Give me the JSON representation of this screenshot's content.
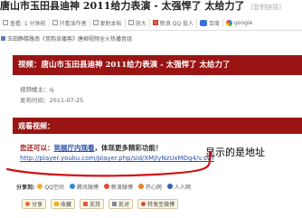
{
  "page_title": {
    "text": "唐山市玉田县迪神 2011给力表演 - 太强悍了 太给力了",
    "tag": "[复制链接]"
  },
  "toolbar": {
    "items": [
      {
        "label": "查看: 1 分钟前",
        "icon": "eye-icon"
      },
      {
        "label": "只看该作者",
        "icon": "user-icon"
      },
      {
        "label": "复制本帖",
        "icon": "copy-icon"
      },
      {
        "label": "放大",
        "icon": "zoom-icon"
      },
      {
        "label": "新浪 QQ 投人",
        "icon": "share-icon"
      },
      {
        "label": "百度",
        "icon": "baidu-icon"
      },
      {
        "label": "google",
        "icon": "google-icon"
      }
    ]
  },
  "breadcrumb": {
    "text": "玉田静楼路南《音韵谈播客》唐柳视频全火热播音组"
  },
  "video_title": "视频：唐山市玉田县迪神 2011给力表演 - 太强悍了 太给力了",
  "meta": {
    "uploader": "视频楼主：sj",
    "date": "发布时间：2011-07-25"
  },
  "watch_header": "观看视频：",
  "share_line": {
    "prefix": "您还可以：",
    "link": "到展厅内观看",
    "suffix": "，体现更多精彩功能！"
  },
  "video_url": "http://player.youku.com/player.php/sid/XMjIyNzUxMDg4/v.swf",
  "annotation": "显示的是地址",
  "share_bar": {
    "label": "分享到:",
    "services": [
      {
        "label": "QQ空间",
        "color": "#f0b030"
      },
      {
        "label": "腾讯微博",
        "color": "#2e8ad8"
      },
      {
        "label": "新浪微博",
        "color": "#e04a3c"
      },
      {
        "label": "开心网",
        "color": "#f08030"
      },
      {
        "label": "人人网",
        "color": "#3060b0"
      }
    ]
  },
  "actions": [
    {
      "label": "分享",
      "icon": "share-icon"
    },
    {
      "label": "收藏",
      "icon": "star-icon"
    },
    {
      "label": "支持",
      "icon": "thumb-up-icon"
    },
    {
      "label": "反对",
      "icon": "thumb-down-icon"
    },
    {
      "label": "转发至微博",
      "icon": "weibo-icon"
    }
  ],
  "colors": {
    "banner_red": "#9a1414",
    "link_blue": "#2a4fa8",
    "annotation_red": "#d41010"
  }
}
